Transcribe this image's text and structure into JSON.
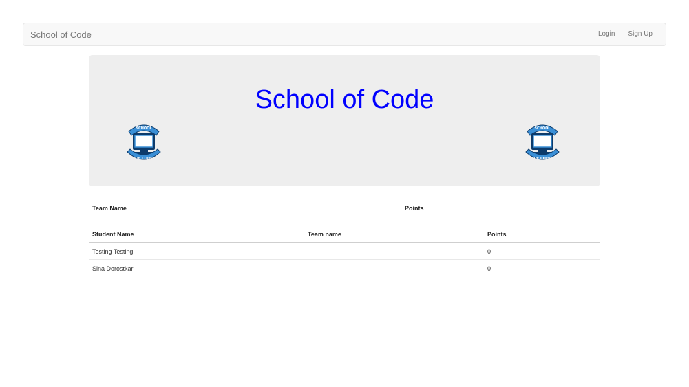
{
  "navbar": {
    "brand": "School of Code",
    "login": "Login",
    "signup": "Sign Up"
  },
  "jumbotron": {
    "title": "School of Code",
    "logo_top_text": "SCHOOL",
    "logo_bottom_text": "OF CODE"
  },
  "teams_table": {
    "headers": {
      "team_name": "Team Name",
      "points": "Points"
    }
  },
  "students_table": {
    "headers": {
      "student_name": "Student Name",
      "team_name": "Team name",
      "points": "Points"
    },
    "rows": [
      {
        "student_name": "Testing Testing",
        "team_name": "",
        "points": "0"
      },
      {
        "student_name": "Sina Dorostkar",
        "team_name": "",
        "points": "0"
      }
    ]
  },
  "colors": {
    "title": "#0000ff",
    "logo_ribbon": "#3a8fd6",
    "logo_dark": "#0d3b6b"
  }
}
